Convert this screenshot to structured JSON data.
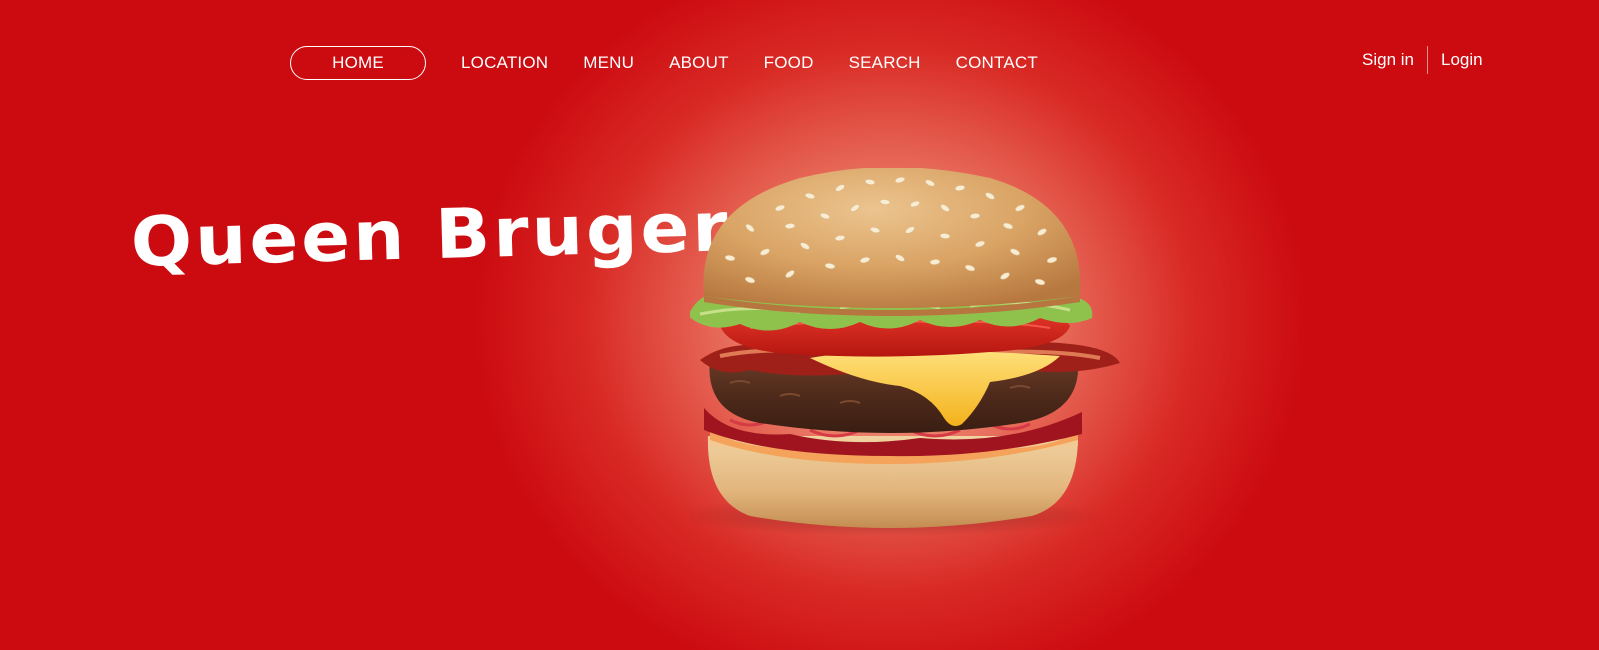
{
  "nav": {
    "items": [
      {
        "label": "HOME",
        "active": true
      },
      {
        "label": "LOCATION",
        "active": false
      },
      {
        "label": "MENU",
        "active": false
      },
      {
        "label": "ABOUT",
        "active": false
      },
      {
        "label": "FOOD",
        "active": false
      },
      {
        "label": "SEARCH",
        "active": false
      },
      {
        "label": "CONTACT",
        "active": false
      }
    ]
  },
  "auth": {
    "sign_in": "Sign in",
    "login": "Login"
  },
  "hero": {
    "brand_title": "Queen Bruger",
    "image": "burger-image"
  },
  "colors": {
    "background": "#cc0b11",
    "glow": "#f7c7a8",
    "text": "#ffffff"
  }
}
